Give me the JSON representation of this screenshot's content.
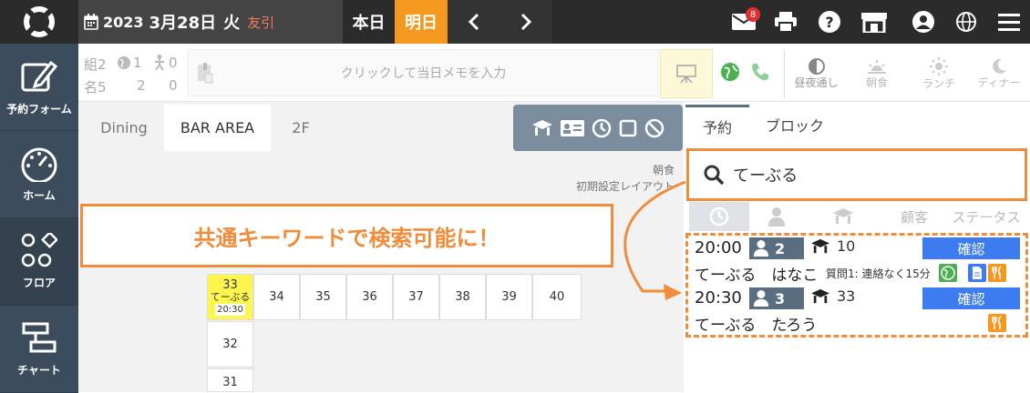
{
  "header": {
    "year": "2023",
    "month_day": "3月28日",
    "weekday": "火",
    "rokuyo": "友引",
    "today_label": "本日",
    "tomorrow_label": "明日",
    "mail_badge": "8"
  },
  "sidebar": {
    "items": [
      {
        "label": "予約フォーム",
        "icon": "edit-icon"
      },
      {
        "label": "ホーム",
        "icon": "gauge-icon"
      },
      {
        "label": "フロア",
        "icon": "floor-icon"
      },
      {
        "label": "チャート",
        "icon": "chart-icon"
      }
    ]
  },
  "infobar": {
    "groups_label": "組",
    "groups_value": "2",
    "web_value": "1",
    "walk_value": "0",
    "people_label": "名",
    "people_value": "5",
    "web_people": "2",
    "walk_people": "0",
    "memo_placeholder": "クリックして当日メモを入力",
    "meals": [
      {
        "label": "昼夜通し",
        "icon": "half-moon-icon"
      },
      {
        "label": "朝食",
        "icon": "sunrise-icon"
      },
      {
        "label": "ランチ",
        "icon": "sun-icon"
      },
      {
        "label": "ディナー",
        "icon": "moon-icon"
      }
    ]
  },
  "floor": {
    "tabs": [
      "Dining",
      "BAR AREA",
      "2F"
    ],
    "active_tab": "BAR AREA",
    "layout_label_1": "朝食",
    "layout_label_2": "初期設定レイアウト",
    "seats_row": [
      "34",
      "35",
      "36",
      "37",
      "38",
      "39",
      "40"
    ],
    "seat_highlight": {
      "number": "33",
      "name": "てーぶる",
      "time": "20:30"
    },
    "seats_col": [
      "32",
      "31"
    ]
  },
  "callout_text": "共通キーワードで検索可能に！",
  "panel": {
    "tabs": [
      "予約",
      "ブロック"
    ],
    "search_value": "てーぶる",
    "columns": {
      "customer": "顧客",
      "status": "ステータス"
    },
    "reservations": [
      {
        "time": "20:00",
        "people": "2",
        "table": "10",
        "status": "確認",
        "name": "てーぶる　はなこ",
        "note": "質問1: 連絡なく15分"
      },
      {
        "time": "20:30",
        "people": "3",
        "table": "33",
        "status": "確認",
        "name": "てーぶる　たろう",
        "note": ""
      }
    ]
  }
}
